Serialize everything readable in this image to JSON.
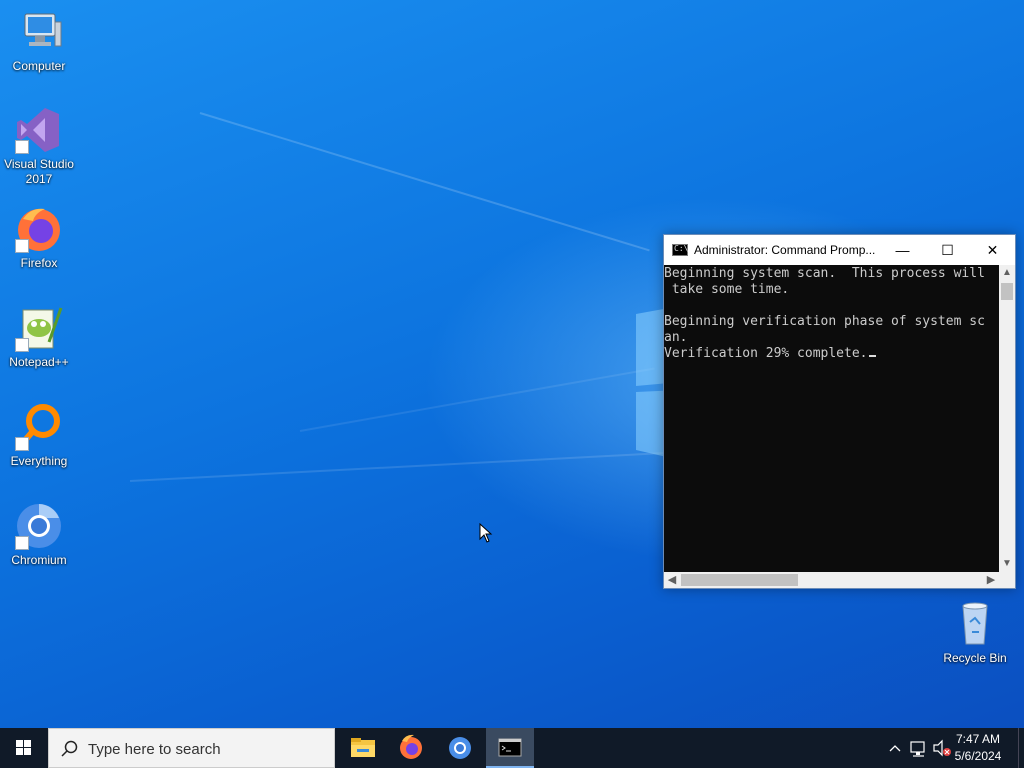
{
  "desktop": {
    "icons": [
      {
        "label": "Computer"
      },
      {
        "label": "Visual Studio 2017"
      },
      {
        "label": "Firefox"
      },
      {
        "label": "Notepad++"
      },
      {
        "label": "Everything"
      },
      {
        "label": "Chromium"
      },
      {
        "label": "Recycle Bin"
      }
    ]
  },
  "cmd_window": {
    "title": "Administrator: Command Promp...",
    "minimize_label": "—",
    "maximize_label": "☐",
    "close_label": "✕",
    "lines": [
      "Beginning system scan.  This process will",
      " take some time.",
      "",
      "Beginning verification phase of system sc",
      "an.",
      "Verification 29% complete."
    ],
    "verification_progress_percent": 29
  },
  "taskbar": {
    "search_placeholder": "Type here to search",
    "pinned": [
      "file-explorer",
      "firefox",
      "chromium",
      "command-prompt"
    ],
    "active_app": "command-prompt",
    "clock_time": "7:47 AM",
    "clock_date": "5/6/2024"
  },
  "colors": {
    "desktop_blue": "#0d74df",
    "taskbar": "#101a28",
    "console_bg": "#0c0c0c",
    "console_fg": "#cccccc"
  }
}
